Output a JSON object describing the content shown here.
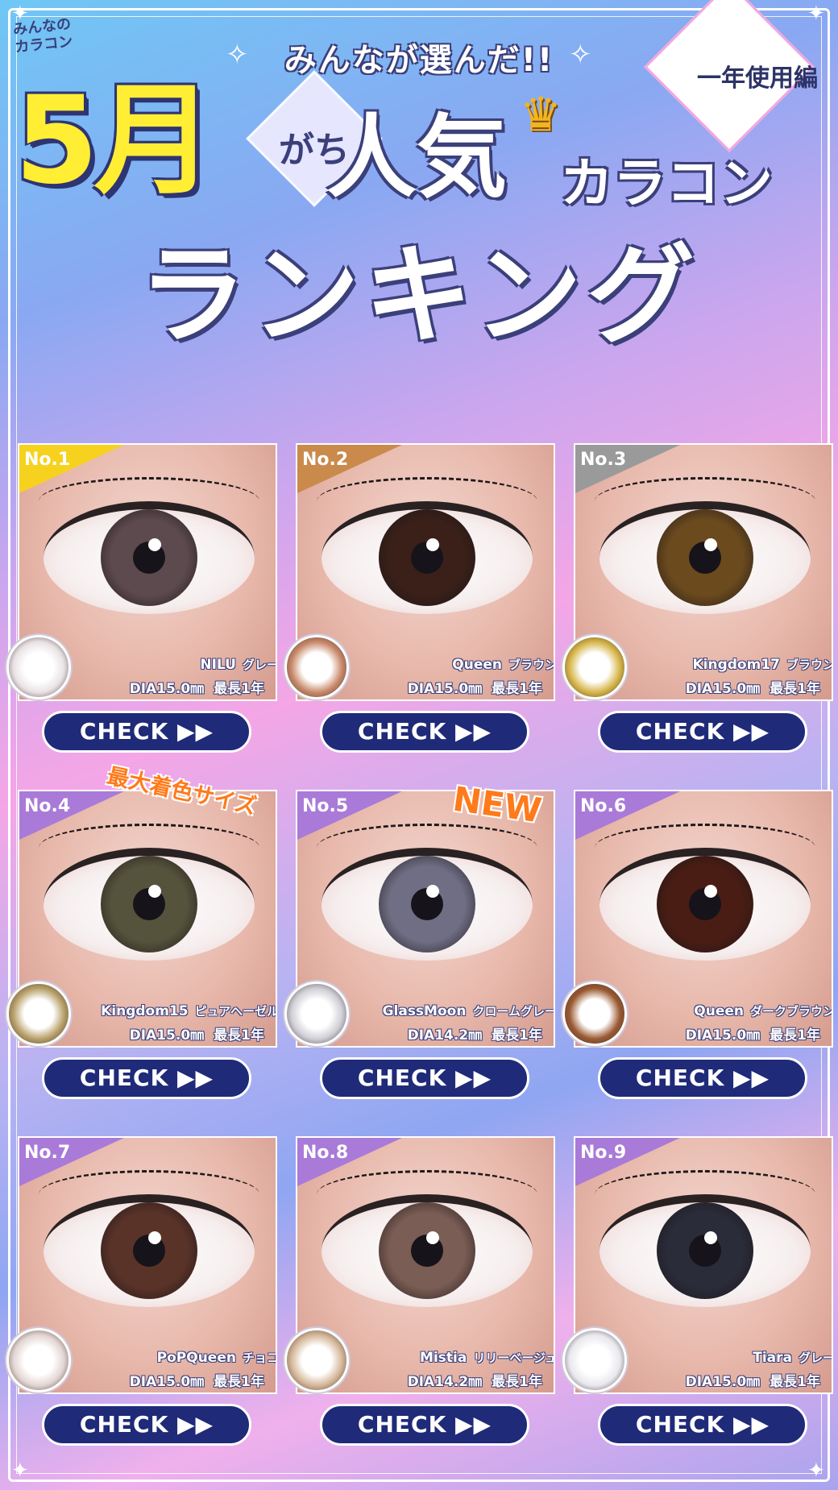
{
  "logo": {
    "line1": "みんなの",
    "line2": "カラコン"
  },
  "header": {
    "headline": "みんなが選んだ!!",
    "edition": "一年使用編",
    "month": "5月",
    "gachi": "がち",
    "ninki": "人気",
    "karakon": "カラコン",
    "ranking": "ランキング"
  },
  "colors": {
    "check_bg": "#1f2a78",
    "navy": "#3b3f7a",
    "gold": "#f6d21f",
    "bronze": "#c98a4b",
    "silver": "#9a9a9a",
    "purple": "#a97ad8"
  },
  "products": [
    {
      "rank": "No.1",
      "name": "NILU",
      "color": "グレー",
      "dia": "DIA15.0㎜",
      "life": "最長1年",
      "tag_color": "#f6d21f",
      "iris": "#5d4a4e",
      "lens": "#e9e2e4",
      "check": "CHECK ▶▶"
    },
    {
      "rank": "No.2",
      "name": "Queen",
      "color": "ブラウン",
      "dia": "DIA15.0㎜",
      "life": "最長1年",
      "tag_color": "#c98a4b",
      "iris": "#3a2019",
      "lens": "#c98a6b",
      "check": "CHECK ▶▶"
    },
    {
      "rank": "No.3",
      "name": "Kingdom17",
      "color": "ブラウン",
      "dia": "DIA15.0㎜",
      "life": "最長1年",
      "tag_color": "#9a9a9a",
      "iris": "#6b4a1e",
      "lens": "#d7b64a",
      "check": "CHECK ▶▶"
    },
    {
      "rank": "No.4",
      "name": "Kingdom15",
      "color": "ピュアヘーゼル",
      "dia": "DIA15.0㎜",
      "life": "最長1年",
      "tag_color": "#a97ad8",
      "iris": "#55533c",
      "lens": "#b8a16a",
      "check": "CHECK ▶▶",
      "badge": "最大着色サイズ"
    },
    {
      "rank": "No.5",
      "name": "GlassMoon",
      "color": "クロームグレー",
      "dia": "DIA14.2㎜",
      "life": "最長1年",
      "tag_color": "#a97ad8",
      "iris": "#6f6e84",
      "lens": "#cfcfd6",
      "check": "CHECK ▶▶",
      "badge": "NEW"
    },
    {
      "rank": "No.6",
      "name": "Queen",
      "color": "ダークブラウン",
      "dia": "DIA15.0㎜",
      "life": "最長1年",
      "tag_color": "#a97ad8",
      "iris": "#4a1d14",
      "lens": "#9a5a32",
      "check": "CHECK ▶▶"
    },
    {
      "rank": "No.7",
      "name": "PoPQueen",
      "color": "チョコ",
      "dia": "DIA15.0㎜",
      "life": "最長1年",
      "tag_color": "#a97ad8",
      "iris": "#5a3328",
      "lens": "#e3d6d2",
      "check": "CHECK ▶▶"
    },
    {
      "rank": "No.8",
      "name": "Mistia",
      "color": "リリーベージュ",
      "dia": "DIA14.2㎜",
      "life": "最長1年",
      "tag_color": "#a97ad8",
      "iris": "#7a5d54",
      "lens": "#d6b89a",
      "check": "CHECK ▶▶"
    },
    {
      "rank": "No.9",
      "name": "Tiara",
      "color": "グレー",
      "dia": "DIA15.0㎜",
      "life": "最長1年",
      "tag_color": "#a97ad8",
      "iris": "#2a2c3a",
      "lens": "#e8e8ee",
      "check": "CHECK ▶▶"
    }
  ]
}
